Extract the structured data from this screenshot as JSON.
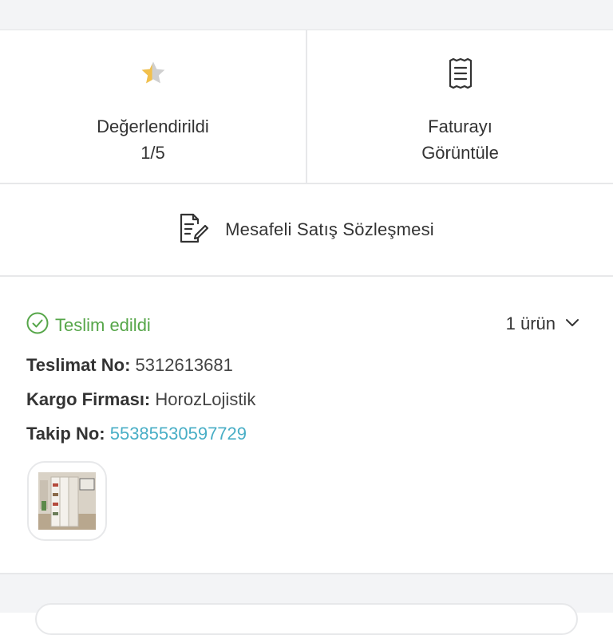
{
  "actions": {
    "rating": {
      "icon": "star-icon",
      "label": "Değerlendirildi\n1/5",
      "value": 1,
      "max": 5
    },
    "invoice": {
      "icon": "receipt-icon",
      "label": "Faturayı\nGörüntüle"
    }
  },
  "contract": {
    "icon": "contract-edit-icon",
    "label": "Mesafeli Satış Sözleşmesi"
  },
  "delivery": {
    "status_icon": "check-circle-icon",
    "status": "Teslim edildi",
    "item_count": "1 ürün",
    "expand_icon": "chevron-down-icon",
    "delivery_no_label": "Teslimat No:",
    "delivery_no": "5312613681",
    "carrier_label": "Kargo Firması:",
    "carrier": "HorozLojistik",
    "tracking_label": "Takip No:",
    "tracking_no": "55385530597729",
    "product_thumbnail": "product-thumbnail"
  },
  "colors": {
    "status_green": "#56a649",
    "link_teal": "#48aec6",
    "star_gold": "#f2c04b",
    "star_gray": "#cfcfcf"
  }
}
